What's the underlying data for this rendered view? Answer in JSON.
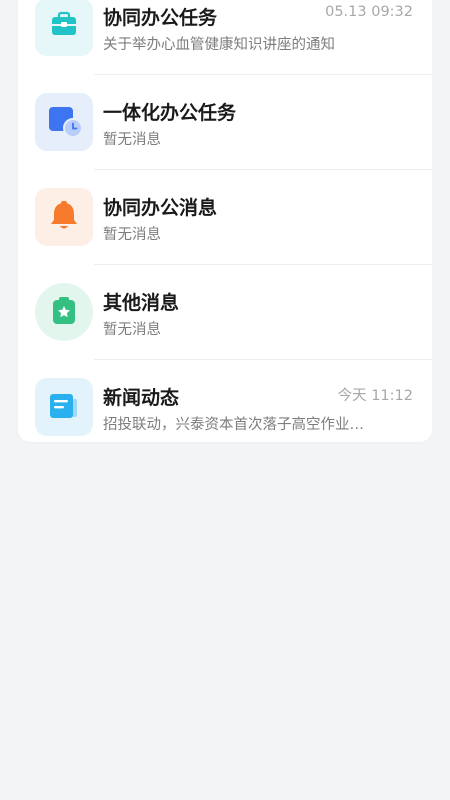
{
  "messages": [
    {
      "title": "协同办公任务",
      "subtitle": "关于举办心血管健康知识讲座的通知",
      "time": "05.13 09:32",
      "icon": "briefcase-icon",
      "icon_bg": "#e5f7f8",
      "icon_color": "#22c3c7"
    },
    {
      "title": "一体化办公任务",
      "subtitle": "暂无消息",
      "time": "",
      "icon": "task-clock-icon",
      "icon_bg": "#e6eefc",
      "icon_color": "#3d74ef"
    },
    {
      "title": "协同办公消息",
      "subtitle": "暂无消息",
      "time": "",
      "icon": "bell-icon",
      "icon_bg": "#fdeee6",
      "icon_color": "#f7792b"
    },
    {
      "title": "其他消息",
      "subtitle": "暂无消息",
      "time": "",
      "icon": "star-clipboard-icon",
      "icon_bg": "#e3f6ee",
      "icon_color": "#33c082"
    },
    {
      "title": "新闻动态",
      "subtitle": "招投联动，兴泰资本首次落子高空作业…",
      "time": "今天 11:12",
      "icon": "news-icon",
      "icon_bg": "#e2f3fb",
      "icon_color": "#2ab0ee"
    }
  ]
}
